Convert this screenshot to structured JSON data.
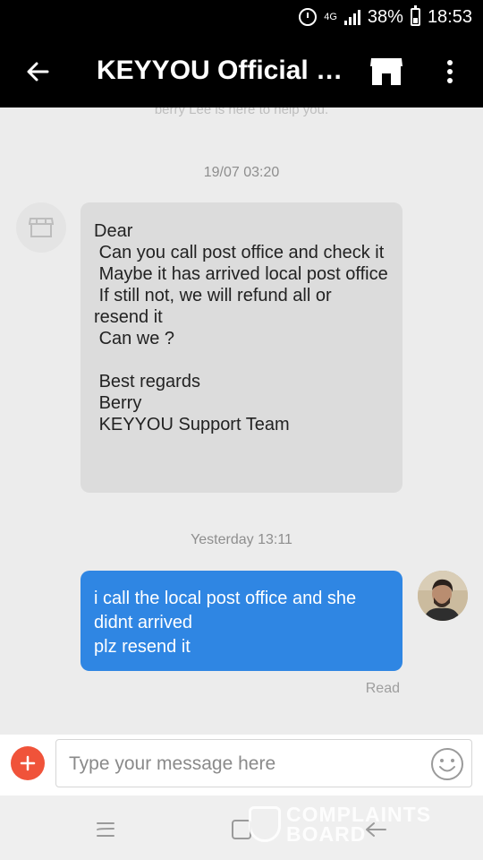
{
  "status_bar": {
    "network": "4G",
    "battery": "38%",
    "time": "18:53"
  },
  "header": {
    "title": "KEYYOU Official S...",
    "back_icon": "arrow-left-icon",
    "store_icon": "store-icon",
    "more_icon": "more-vertical-icon"
  },
  "chat": {
    "system_note": "berry Lee is here to help you.",
    "messages": [
      {
        "timestamp": "19/07 03:20",
        "direction": "incoming",
        "lines": [
          "Dear",
          " Can you call post office and check it",
          " Maybe it has arrived local post office",
          " If still not, we will refund all or resend it",
          " Can we ?",
          "",
          " Best regards",
          " Berry",
          " KEYYOU Support Team"
        ]
      },
      {
        "timestamp": "Yesterday 13:11",
        "direction": "outgoing",
        "lines": [
          "i call the local post office and she didnt arrived",
          "plz resend it"
        ],
        "status": "Read"
      }
    ]
  },
  "input": {
    "placeholder": "Type your message here",
    "value": "",
    "add_icon": "plus-icon",
    "emoji_icon": "smiley-icon"
  },
  "watermark": {
    "line1": "COMPLAINTS",
    "line2": "BOARD"
  },
  "colors": {
    "header_bg": "#000000",
    "incoming_bubble": "#dcdcdc",
    "outgoing_bubble": "#2f86e3",
    "add_button": "#f0533a"
  }
}
